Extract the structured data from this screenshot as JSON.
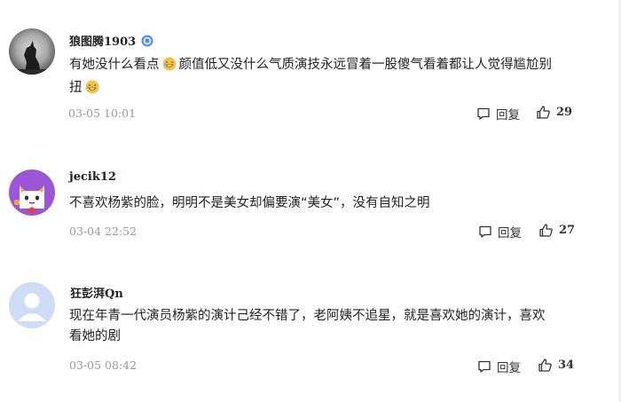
{
  "comments": [
    {
      "username": "狼图腾1903",
      "verified": true,
      "text_line1": "有她没什么看点",
      "text_line1b": "颜值低又没什么气质演技永远冒着一股傻气看着都让人觉得尴尬别",
      "text_line2": "扭",
      "time": "03-05 10:01",
      "reply_label": "回复",
      "likes": "29"
    },
    {
      "username": "jecik12",
      "verified": false,
      "text": "不喜欢杨紫的脸，明明不是美女却偏要演“美女”，没有自知之明",
      "time": "03-04 22:52",
      "reply_label": "回复",
      "likes": "27"
    },
    {
      "username": "狂彭湃Qn",
      "verified": false,
      "text_line1": "现在年青一代演员杨紫的演计己经不错了，老阿姨不追星，就是喜欢她的演计，喜欢",
      "text_line2": "看她的剧",
      "time": "03-05 08:42",
      "reply_label": "回复",
      "likes": "34"
    }
  ],
  "colors": {
    "text": "#222222",
    "muted": "#999999",
    "verified": "#4c8dff"
  },
  "icons": [
    "wolf-avatar",
    "cat-avatar",
    "default-avatar",
    "verified-icon",
    "grin-emoji-icon",
    "comment-icon",
    "thumbs-up-icon"
  ]
}
